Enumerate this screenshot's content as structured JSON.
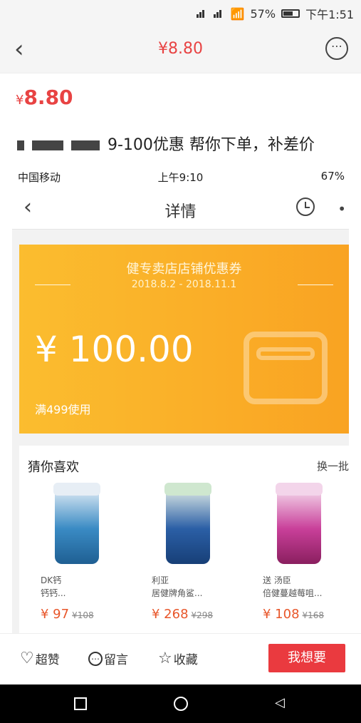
{
  "status_bar": {
    "battery": "57%",
    "time": "下午1:51"
  },
  "app_bar": {
    "price": "¥8.80"
  },
  "listing": {
    "price_symbol": "¥",
    "price_value": "8.80",
    "description_visible": "9-100优惠 帮你下单，补差价"
  },
  "inner_screenshot": {
    "status": {
      "carrier": "中国移动",
      "time": "上午9:10",
      "battery": "67%"
    },
    "nav_title": "详情",
    "coupon": {
      "title_suffix": "健专卖店店铺优惠券",
      "date_range": "2018.8.2 - 2018.11.1",
      "amount": "¥ 100.00",
      "condition": "满499使用"
    },
    "recommend": {
      "header": "猜你喜欢",
      "switch_label": "换一批",
      "items": [
        {
          "title_line1": "DK钙",
          "title_line2": "钙钙...",
          "price": "¥ 97",
          "old_price": "¥108"
        },
        {
          "title_line1": "利亚",
          "title_line2": "居健牌角鲨...",
          "price": "¥ 268",
          "old_price": "¥298"
        },
        {
          "title_line1": "送 汤臣",
          "title_line2": "倍健蔓越莓咀...",
          "price": "¥ 108",
          "old_price": "¥168"
        }
      ]
    }
  },
  "bottom_bar": {
    "like": "超赞",
    "comment": "留言",
    "favorite": "收藏",
    "want": "我想要"
  },
  "colors": {
    "accent_red": "#e84343",
    "coupon_orange": "#f9a322",
    "button_red": "#ea3a3f"
  }
}
